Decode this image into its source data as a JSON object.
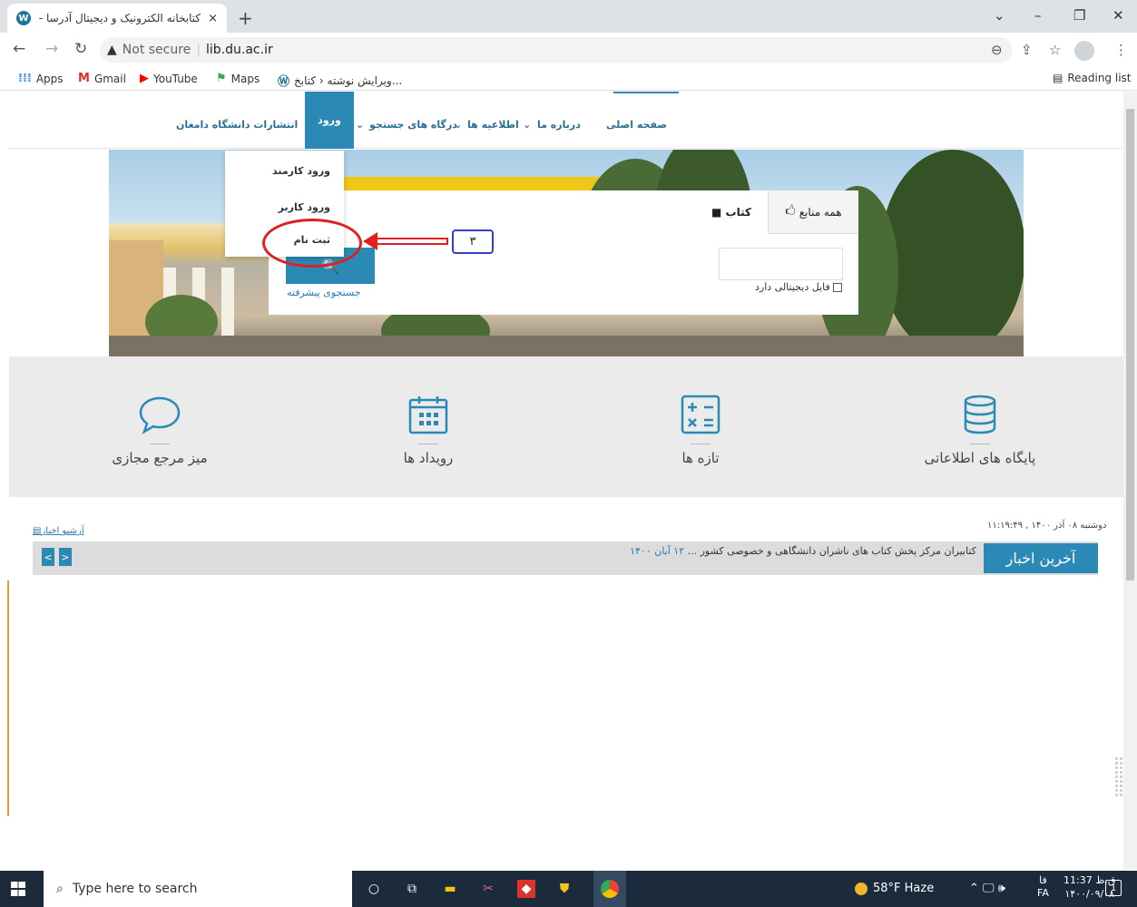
{
  "browser": {
    "tab_title": "کتابخانه الکترونیک و دیجیتال آدرسا -",
    "tab_close": "×",
    "new_tab": "+",
    "security_label": "Not secure",
    "url": "lib.du.ac.ir",
    "window_controls": {
      "chevron": "⌄",
      "minimize": "–",
      "restore": "❐",
      "close": "✕"
    },
    "bookmarks": [
      {
        "label": "Apps",
        "icon": "apps-grid-icon"
      },
      {
        "label": "Gmail",
        "icon": "gmail-icon"
      },
      {
        "label": "YouTube",
        "icon": "youtube-icon"
      },
      {
        "label": "Maps",
        "icon": "maps-icon"
      },
      {
        "label": "ویرایش نوشته ‹ کتابخ...",
        "icon": "wordpress-icon"
      }
    ],
    "reading_list": "Reading list"
  },
  "nav": {
    "home": "صفحه اصلی",
    "about": "درباره ما",
    "news": "اطلاعیه ها",
    "portals": "درگاه های جستجو",
    "login": "ورود",
    "publications": "انتشارات دانشگاه دامغان",
    "chevron": "⌄"
  },
  "login_menu": {
    "items": [
      "ورود کارمند",
      "ورود کاربر",
      "ثبت نام"
    ]
  },
  "search": {
    "tab_all": "همه منابع",
    "tab_book": "کتاب",
    "digital_file": "فایل دیجیتالی دارد",
    "advanced": "جستجوی پیشرفته",
    "button_icon": "search-icon"
  },
  "annotation": {
    "step_number": "۳"
  },
  "features": [
    {
      "label": "پایگاه های اطلاعاتی",
      "icon": "database-icon"
    },
    {
      "label": "تازه ها",
      "icon": "calculator-icon"
    },
    {
      "label": "رویداد ها",
      "icon": "calendar-icon"
    },
    {
      "label": "میز مرجع مجازی",
      "icon": "chat-bubble-icon"
    }
  ],
  "news": {
    "date": "دوشنبه ۰۸ آذر ۱۴۰۰ , ۱۱:۱۹:۴۹",
    "archive": "آرشیو اخبار",
    "title": "آخرین اخبار",
    "item": "کتابیران مرکز پخش کتاب های ناشران دانشگاهی و خصوصی کشور ...",
    "item_date": "۱۲ آبان ۱۴۰۰",
    "prev": "<",
    "next": ">"
  },
  "taskbar": {
    "search_placeholder": "Type here to search",
    "weather": "58°F  Haze",
    "tray": "⌃  🖵  🕪",
    "lang_top": "فا",
    "lang_bottom": "FA",
    "time": "11:37 ق.ظ",
    "date": "۱۴۰۰/۰۹/۰۸",
    "notifications": "1"
  },
  "colors": {
    "accent": "#2a8ab5",
    "annotation_red": "#e02020",
    "annotation_blue": "#3a3ad0"
  }
}
